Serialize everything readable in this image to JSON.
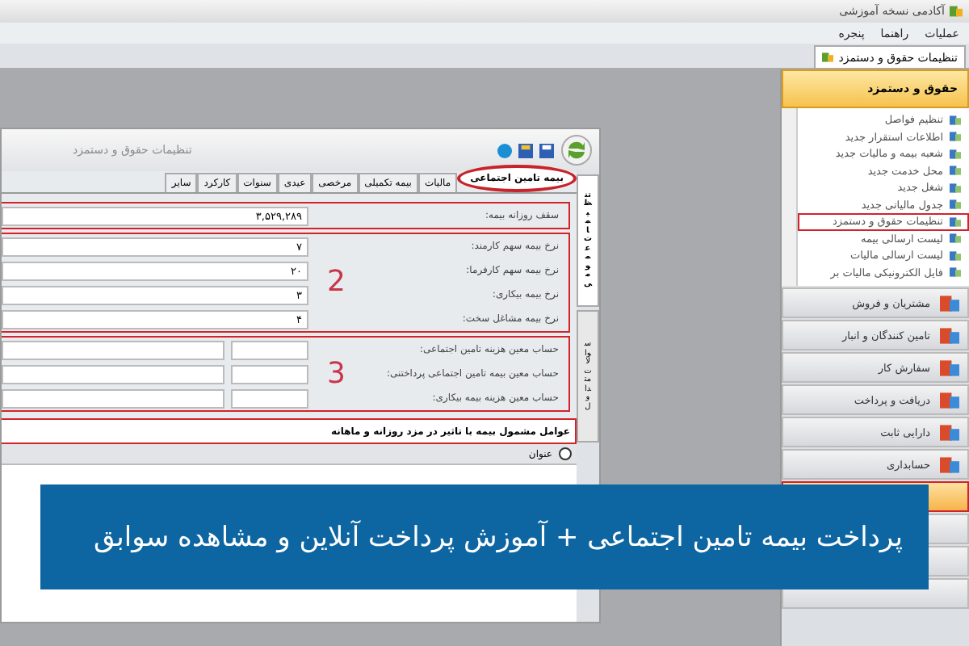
{
  "window": {
    "title": "آکادمی نسخه آموزشی"
  },
  "menu": [
    "عملیات",
    "راهنما",
    "پنجره"
  ],
  "doc_tabs": [
    {
      "label": "تنظیمات حقوق و دستمزد",
      "selected": true
    }
  ],
  "settings_window": {
    "title": "تنظیمات حقوق و دستمزد",
    "side_tabs": [
      {
        "label": "تنظیمات عمومی",
        "selected": true
      },
      {
        "label": "سوالات متداول",
        "selected": false
      }
    ],
    "tabs": [
      {
        "label": "بیمه تامین اجتماعی",
        "selected": true,
        "circled": true
      },
      {
        "label": "مالیات",
        "selected": false,
        "circled": false
      },
      {
        "label": "بیمه تکمیلی",
        "selected": false,
        "circled": false
      },
      {
        "label": "مرخصی",
        "selected": false,
        "circled": false
      },
      {
        "label": "عیدی",
        "selected": false,
        "circled": false
      },
      {
        "label": "سنوات",
        "selected": false,
        "circled": false
      },
      {
        "label": "کارکرد",
        "selected": false,
        "circled": false
      },
      {
        "label": "سایر",
        "selected": false,
        "circled": false
      }
    ],
    "groups": [
      {
        "rows": [
          {
            "kind": "single",
            "label": "سقف روزانه بیمه:",
            "value": "۳,۵۲۹,۲۸۹"
          }
        ]
      },
      {
        "marker": "2",
        "rows": [
          {
            "kind": "single",
            "label": "نرخ بیمه سهم کارمند:",
            "value": "۷"
          },
          {
            "kind": "single",
            "label": "نرخ بیمه سهم کارفرما:",
            "value": "۲۰"
          },
          {
            "kind": "single",
            "label": "نرخ بیمه بیکاری:",
            "value": "۳"
          },
          {
            "kind": "single",
            "label": "نرخ بیمه مشاغل سخت:",
            "value": "۴"
          }
        ]
      },
      {
        "marker": "3",
        "rows": [
          {
            "kind": "double",
            "label": "حساب معین هزینه تامین اجتماعی:"
          },
          {
            "kind": "double",
            "label": "حساب معین بیمه تامین اجتماعی پرداختنی:"
          },
          {
            "kind": "double",
            "label": "حساب معین هزینه بیمه بیکاری:"
          }
        ]
      }
    ],
    "factors": {
      "title": "عوامل مشمول بیمه با تاثیر در مزد روزانه و ماهانه",
      "column": "عنوان",
      "selected": false
    }
  },
  "nav": {
    "title": "حقوق و دستمزد",
    "items": [
      {
        "label": "تنظیم فواصل",
        "highlighted": false
      },
      {
        "label": "اطلاعات استقرار جدید",
        "highlighted": false
      },
      {
        "label": "شعبه بیمه و مالیات جدید",
        "highlighted": false
      },
      {
        "label": "محل خدمت جدید",
        "highlighted": false
      },
      {
        "label": "شغل جدید",
        "highlighted": false
      },
      {
        "label": "جدول مالیاتی جدید",
        "highlighted": false
      },
      {
        "label": "تنظیمات حقوق و دستمزد",
        "highlighted": true
      },
      {
        "label": "لیست ارسالی بیمه",
        "highlighted": false
      },
      {
        "label": "لیست ارسالی مالیات",
        "highlighted": false
      },
      {
        "label": "فایل الکترونیکی مالیات بر",
        "highlighted": false
      }
    ],
    "categories": [
      {
        "label": "مشتریان و فروش",
        "selected": false
      },
      {
        "label": "تامین کنندگان و انبار",
        "selected": false
      },
      {
        "label": "سفارش کار",
        "selected": false
      },
      {
        "label": "دریافت و پرداخت",
        "selected": false
      },
      {
        "label": "دارایی ثابت",
        "selected": false
      },
      {
        "label": "حسابداری",
        "selected": false
      },
      {
        "selected": true
      },
      {
        "selected": false
      },
      {
        "selected": false
      },
      {
        "selected": false
      }
    ]
  },
  "banner": {
    "text": "پرداخت بیمه تامین اجتماعی + آموزش پرداخت آنلاین و مشاهده سوابق"
  }
}
